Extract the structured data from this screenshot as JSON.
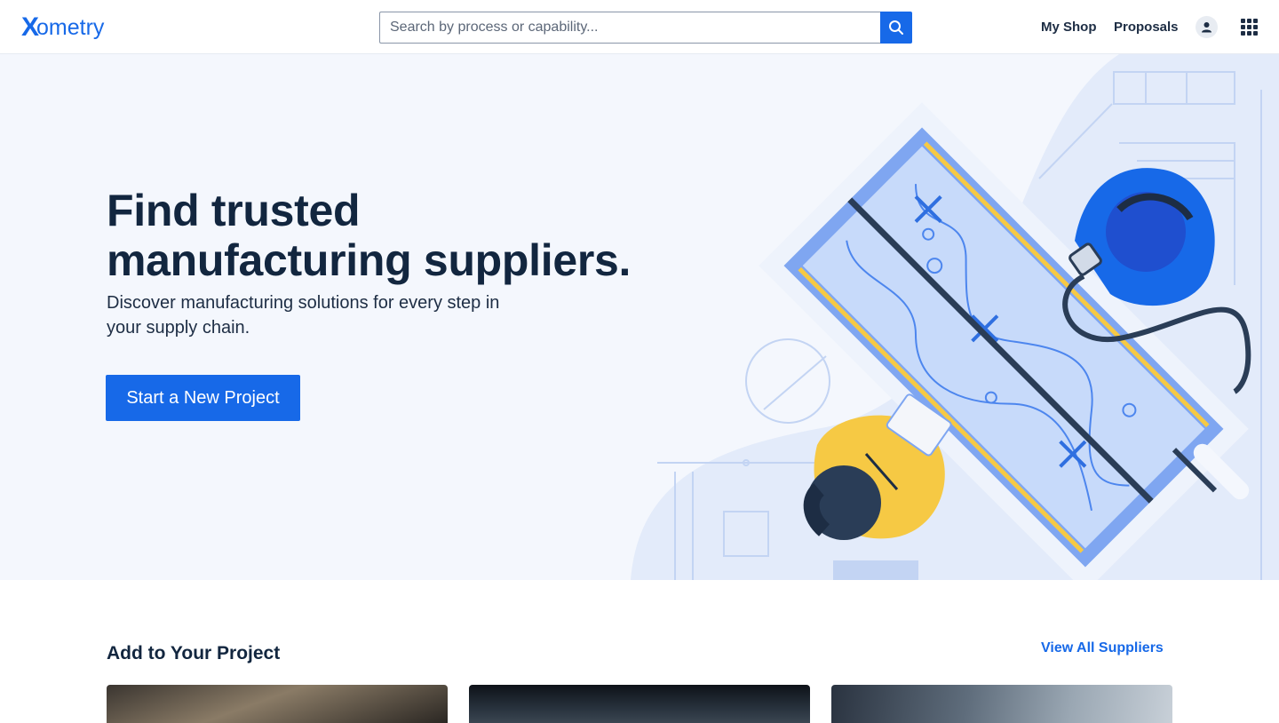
{
  "header": {
    "logo_x": "X",
    "logo_word": "ometry",
    "search_placeholder": "Search by process or capability...",
    "nav": {
      "my_shop": "My Shop",
      "proposals": "Proposals"
    },
    "icons": {
      "search": "search-icon",
      "user": "user-icon",
      "apps": "apps-grid-icon"
    }
  },
  "hero": {
    "title_line1": "Find trusted",
    "title_line2": "manufacturing suppliers.",
    "subtitle_line1": "Discover manufacturing solutions for every step in",
    "subtitle_line2": "your supply chain.",
    "cta_label": "Start a New Project"
  },
  "section": {
    "title": "Add to Your Project",
    "view_all": "View All Suppliers"
  },
  "colors": {
    "brand_blue": "#1769e8",
    "navy_text": "#12263f",
    "hero_bg": "#f4f7fd",
    "accent_yellow": "#f6c944"
  }
}
